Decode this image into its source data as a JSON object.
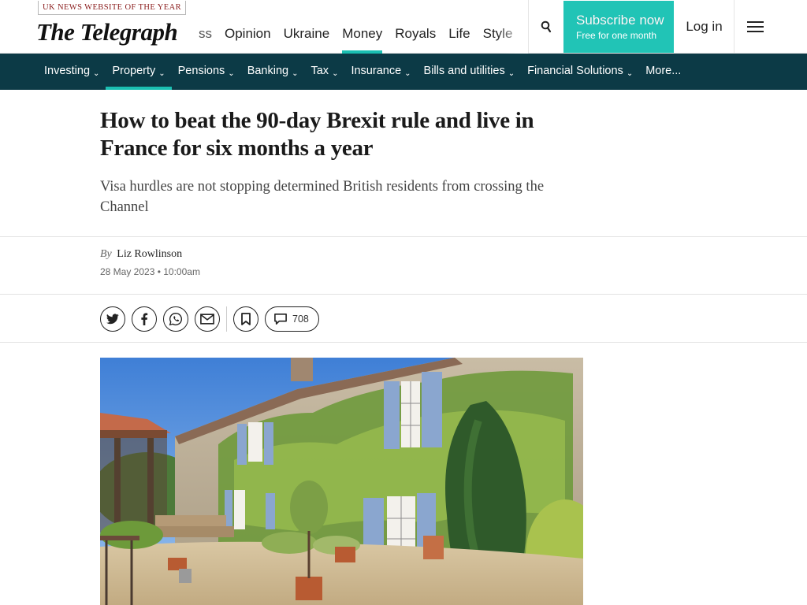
{
  "header": {
    "award": "UK NEWS WEBSITE OF THE YEAR",
    "logo": "The Telegraph",
    "nav": [
      {
        "label": "ss",
        "active": false
      },
      {
        "label": "Opinion",
        "active": false
      },
      {
        "label": "Ukraine",
        "active": false
      },
      {
        "label": "Money",
        "active": true
      },
      {
        "label": "Royals",
        "active": false
      },
      {
        "label": "Life",
        "active": false
      },
      {
        "label": "Style",
        "active": false
      }
    ],
    "search_icon": "search-icon",
    "subscribe": {
      "label": "Subscribe now",
      "sub": "Free for one month"
    },
    "login": "Log in",
    "menu_icon": "hamburger-menu-icon",
    "accent": "#21c4b6"
  },
  "section_nav": {
    "background": "#0c3a46",
    "items": [
      {
        "label": "Investing",
        "dropdown": true,
        "active": false
      },
      {
        "label": "Property",
        "dropdown": true,
        "active": true
      },
      {
        "label": "Pensions",
        "dropdown": true,
        "active": false
      },
      {
        "label": "Banking",
        "dropdown": true,
        "active": false
      },
      {
        "label": "Tax",
        "dropdown": true,
        "active": false
      },
      {
        "label": "Insurance",
        "dropdown": true,
        "active": false
      },
      {
        "label": "Bills and utilities",
        "dropdown": true,
        "active": false
      },
      {
        "label": "Financial Solutions",
        "dropdown": true,
        "active": false
      },
      {
        "label": "More...",
        "dropdown": false,
        "active": false
      }
    ]
  },
  "article": {
    "headline": "How to beat the 90-day Brexit rule and live in France for six months a year",
    "standfirst": "Visa hurdles are not stopping determined British residents from crossing the Channel",
    "byline_prefix": "By",
    "author": "Liz Rowlinson",
    "date": "28 May 2023 • 10:00am",
    "share": {
      "icons": [
        "twitter-icon",
        "facebook-icon",
        "whatsapp-icon",
        "email-icon"
      ],
      "bookmark_icon": "bookmark-icon",
      "comment_count": "708"
    }
  }
}
